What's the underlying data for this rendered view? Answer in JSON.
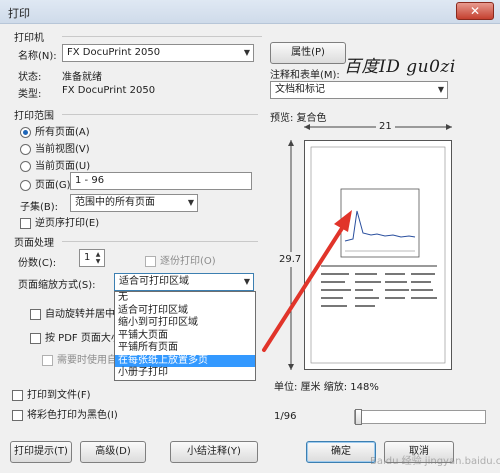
{
  "window": {
    "title": "打印",
    "close": "✕"
  },
  "printer": {
    "section_title": "打印机",
    "name_label": "名称(N):",
    "name_value": "FX DocuPrint 2050",
    "properties_button": "属性(P)",
    "status_label": "状态:",
    "status_value": "准备就绪",
    "type_label": "类型:",
    "type_value": "FX DocuPrint 2050"
  },
  "annotations": {
    "label": "注释和表单(M):",
    "value": "文档和标记"
  },
  "watermark": "百度ID  gu0zi",
  "range": {
    "section_title": "打印范围",
    "options": [
      "所有页面(A)",
      "当前视图(V)",
      "当前页面(U)",
      "页面(G)"
    ],
    "pages_value": "1 - 96",
    "subset_label": "子集(B):",
    "subset_value": "范围中的所有页面",
    "reverse_label": "逆页序打印(E)"
  },
  "handling": {
    "section_title": "页面处理",
    "copies_label": "份数(C):",
    "copies_value": "1",
    "collate_label": "逐份打印(O)",
    "scaling_label": "页面缩放方式(S):",
    "scaling_value": "适合可打印区域",
    "scaling_options": [
      "无",
      "适合可打印区域",
      "缩小到可打印区域",
      "平铺大页面",
      "平铺所有页面",
      "在每张纸上放置多页",
      "小册子打印"
    ],
    "auto_rotate_label": "自动旋转并居中",
    "choose_paper_label": "按 PDF 页面大小",
    "custom_paper_label": "需要时使用自"
  },
  "output": {
    "print_to_file": "打印到文件(F)",
    "print_grayscale": "将彩色打印为黑色(I)"
  },
  "preview": {
    "label": "预览: 复合色",
    "width_label": "21",
    "height_label": "29.7",
    "units": "单位: 厘米  缩放: 148%",
    "page_counter": "1/96"
  },
  "buttons": {
    "tips": "打印提示(T)",
    "advanced": "高级(D)",
    "summarize": "小结注释(Y)",
    "ok": "确定",
    "cancel": "取消"
  },
  "footer_watermark": "Baidu 经验 jingyan.baidu.com"
}
